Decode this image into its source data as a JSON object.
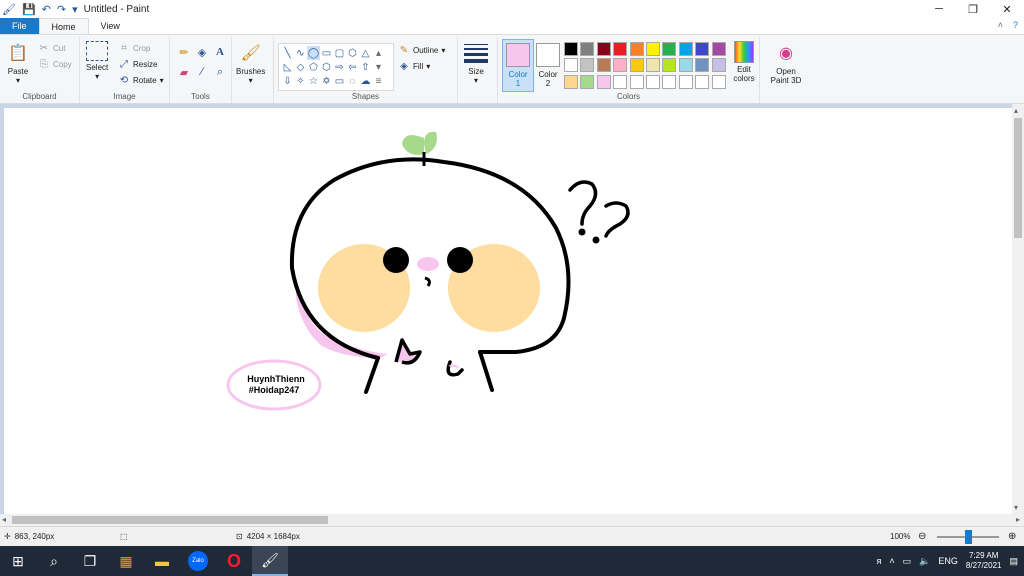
{
  "window": {
    "title": "Untitled - Paint"
  },
  "tabs": [
    {
      "label": "File"
    },
    {
      "label": "Home"
    },
    {
      "label": "View"
    }
  ],
  "ribbon": {
    "clipboard": {
      "paste": "Paste",
      "cut": "Cut",
      "copy": "Copy",
      "label": "Clipboard"
    },
    "image": {
      "select": "Select",
      "crop": "Crop",
      "resize": "Resize",
      "rotate": "Rotate",
      "label": "Image"
    },
    "tools": {
      "label": "Tools"
    },
    "brushes": {
      "label": "Brushes"
    },
    "shapes": {
      "outline": "Outline",
      "fill": "Fill",
      "label": "Shapes"
    },
    "size": {
      "label": "Size"
    },
    "colors": {
      "color1": "Color\n1",
      "color2": "Color\n2",
      "edit": "Edit colors",
      "label": "Colors",
      "color1_value": "#f7c6ef",
      "color2_value": "#ffffff",
      "palette": [
        "#000000",
        "#7f7f7f",
        "#880015",
        "#ed1c24",
        "#ff7f27",
        "#fff200",
        "#22b14c",
        "#00a2e8",
        "#3f48cc",
        "#a349a4",
        "#ffffff",
        "#c3c3c3",
        "#b97a57",
        "#ffaec9",
        "#ffc90e",
        "#efe4b0",
        "#b5e61d",
        "#99d9ea",
        "#7092be",
        "#c8bfe7",
        "#ffd68f",
        "#a6d98a",
        "#f7c6ef",
        "#ffffff",
        "#ffffff",
        "#ffffff",
        "#ffffff",
        "#ffffff",
        "#ffffff",
        "#ffffff"
      ]
    },
    "paint3d": "Open Paint 3D"
  },
  "canvas": {
    "drawing_text_line1": "HuynhThienn",
    "drawing_text_line2": "#Hoidap247"
  },
  "status": {
    "cursor_pos": "863, 240px",
    "canvas_size": "4204 × 1684px",
    "zoom": "100%"
  },
  "taskbar": {
    "zalo": "Zalo",
    "lang": "ENG",
    "time": "7:29 AM",
    "date": "8/27/2021"
  }
}
